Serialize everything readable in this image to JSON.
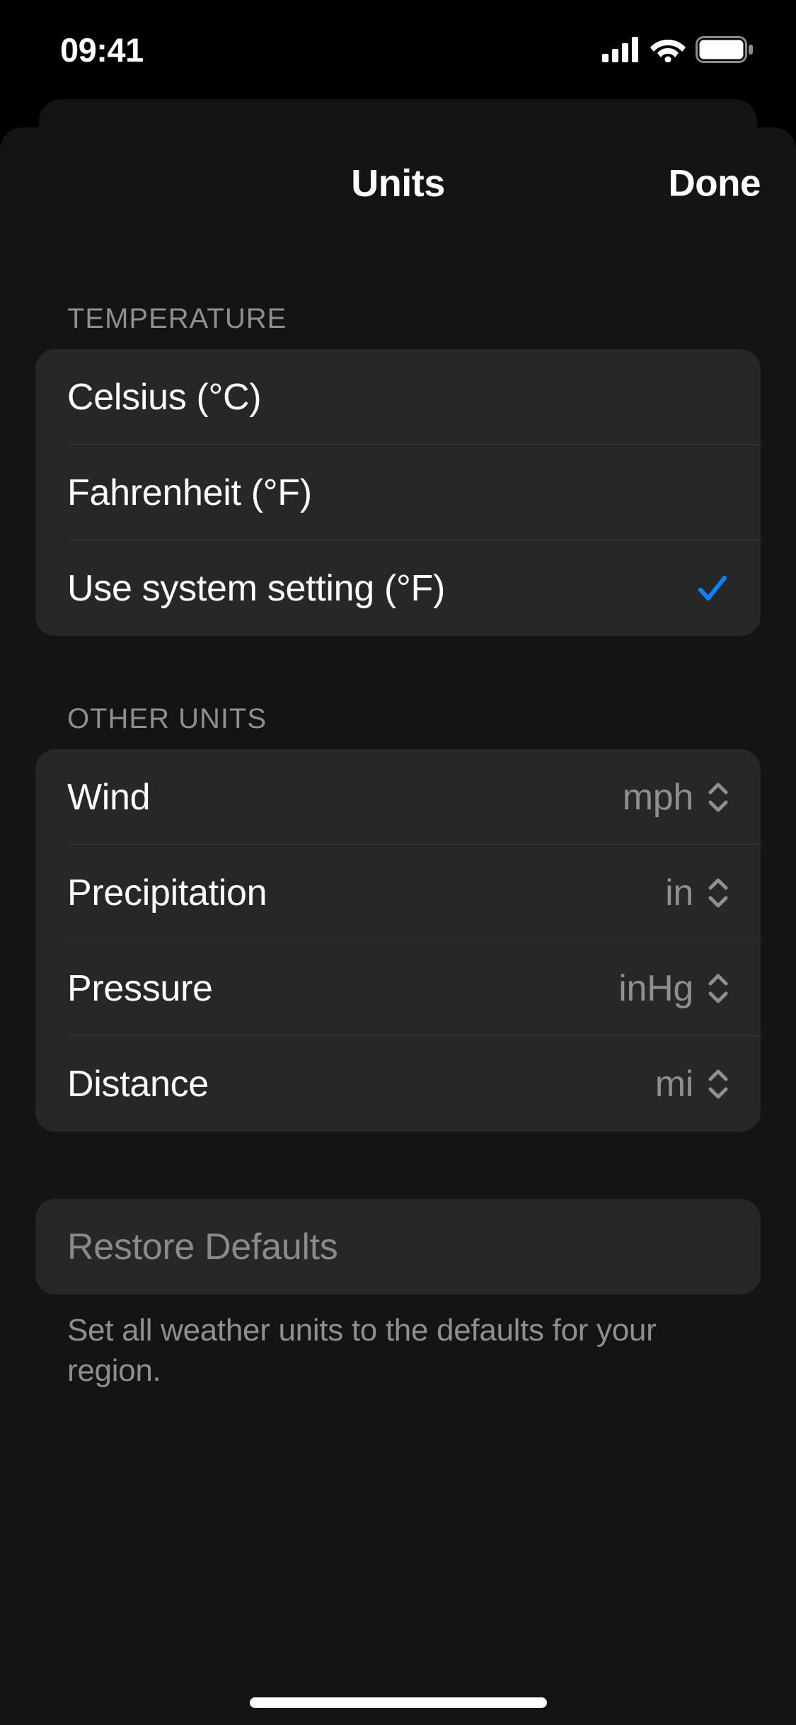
{
  "status": {
    "time": "09:41"
  },
  "sheet": {
    "title": "Units",
    "done": "Done"
  },
  "temperature": {
    "header": "TEMPERATURE",
    "rows": [
      {
        "label": "Celsius (°C)",
        "selected": false
      },
      {
        "label": "Fahrenheit (°F)",
        "selected": false
      },
      {
        "label": "Use system setting (°F)",
        "selected": true
      }
    ]
  },
  "other": {
    "header": "OTHER UNITS",
    "rows": [
      {
        "label": "Wind",
        "value": "mph"
      },
      {
        "label": "Precipitation",
        "value": "in"
      },
      {
        "label": "Pressure",
        "value": "inHg"
      },
      {
        "label": "Distance",
        "value": "mi"
      }
    ]
  },
  "restore": {
    "label": "Restore Defaults",
    "footer": "Set all weather units to the defaults for your region."
  }
}
